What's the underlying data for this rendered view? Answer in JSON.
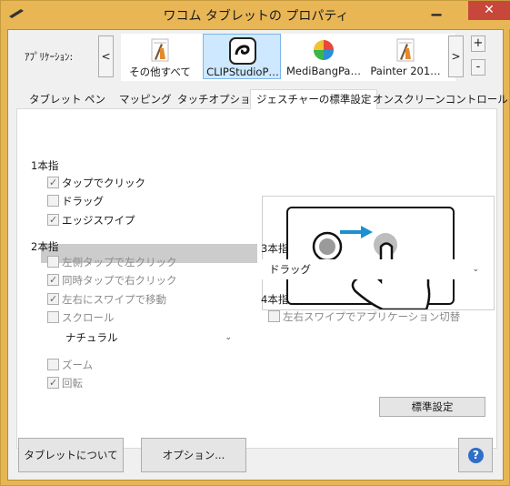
{
  "window": {
    "title": "ワコム タブレットの プロパティ",
    "minimize_glyph": "▁",
    "close_glyph": "✕"
  },
  "apps": {
    "label": "ｱﾌﾟﾘｹｰｼｮﾝ:",
    "prev_glyph": "<",
    "next_glyph": ">",
    "add_glyph": "+",
    "remove_glyph": "-",
    "items": [
      {
        "label": "その他すべて",
        "icon": "all-apps-icon",
        "selected": false
      },
      {
        "label": "CLIPStudioP…",
        "icon": "clip-studio-icon",
        "selected": true
      },
      {
        "label": "MediBangPa…",
        "icon": "medibang-icon",
        "selected": false
      },
      {
        "label": "Painter  201…",
        "icon": "painter-icon",
        "selected": false
      }
    ]
  },
  "tabs": [
    {
      "label": "タブレット"
    },
    {
      "label": "ペン"
    },
    {
      "label": "マッピング"
    },
    {
      "label": "タッチオプション"
    },
    {
      "label": "ジェスチャーの標準設定",
      "active": true
    },
    {
      "label": "オンスクリーンコントロール"
    }
  ],
  "one_finger": {
    "heading": "1本指",
    "items": [
      {
        "label": "タップでクリック",
        "checked": true
      },
      {
        "label": "ドラッグ",
        "checked": false
      },
      {
        "label": "エッジスワイプ",
        "checked": true
      }
    ]
  },
  "two_finger": {
    "heading": "2本指",
    "items": [
      {
        "label": "左側タップで左クリック",
        "checked": false
      },
      {
        "label": "同時タップで右クリック",
        "checked": true
      },
      {
        "label": "左右にスワイプで移動",
        "checked": true
      },
      {
        "label": "スクロール",
        "checked": false
      },
      {
        "label": "ズーム",
        "checked": false
      },
      {
        "label": "回転",
        "checked": true
      }
    ],
    "scroll_mode": "ナチュラル"
  },
  "three_finger": {
    "heading": "3本指",
    "value": "ドラッグ"
  },
  "four_finger": {
    "heading": "4本指",
    "items": [
      {
        "label": "左右スワイプでアプリケーション切替",
        "checked": false
      }
    ]
  },
  "buttons": {
    "defaults": "標準設定",
    "about": "タブレットについて",
    "options": "オプション...",
    "help_glyph": "?"
  },
  "colors": {
    "accent": "#1e8fd0",
    "title_bar": "#e8b654",
    "close": "#c7473b",
    "selected_app": "#cde8ff"
  },
  "chevron_glyph": "⌄"
}
